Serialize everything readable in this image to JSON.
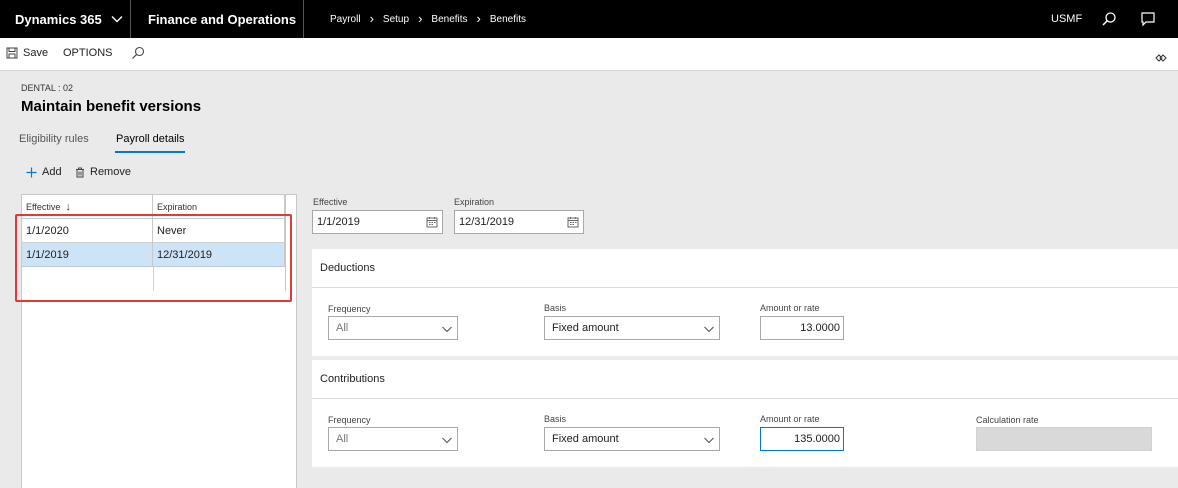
{
  "nav": {
    "brand": "Dynamics 365",
    "app": "Finance and Operations",
    "breadcrumb": [
      "Payroll",
      "Setup",
      "Benefits",
      "Benefits"
    ],
    "company": "USMF"
  },
  "actionbar": {
    "save_label": "Save",
    "options_label": "OPTIONS"
  },
  "header": {
    "caption": "DENTAL : 02",
    "title": "Maintain benefit versions"
  },
  "tabs": [
    {
      "label": "Eligibility rules",
      "active": false
    },
    {
      "label": "Payroll details",
      "active": true
    }
  ],
  "grid_toolbar": {
    "add_label": "Add",
    "remove_label": "Remove"
  },
  "grid": {
    "columns": [
      "Effective",
      "Expiration"
    ],
    "sort_indicator": "↓",
    "rows": [
      {
        "effective": "1/1/2020",
        "expiration": "Never",
        "selected": false
      },
      {
        "effective": "1/1/2019",
        "expiration": "12/31/2019",
        "selected": true
      }
    ]
  },
  "dates": {
    "effective_label": "Effective",
    "effective_value": "1/1/2019",
    "expiration_label": "Expiration",
    "expiration_value": "12/31/2019"
  },
  "deductions": {
    "title": "Deductions",
    "frequency_label": "Frequency",
    "frequency_value": "All",
    "basis_label": "Basis",
    "basis_value": "Fixed amount",
    "amount_label": "Amount or rate",
    "amount_value": "13.0000"
  },
  "contributions": {
    "title": "Contributions",
    "frequency_label": "Frequency",
    "frequency_value": "All",
    "basis_label": "Basis",
    "basis_value": "Fixed amount",
    "amount_label": "Amount or rate",
    "amount_value": "135.0000",
    "calc_rate_label": "Calculation rate",
    "calc_rate_value": ""
  },
  "colors": {
    "nav_bg": "#000000",
    "accent": "#0078d4",
    "selected_row": "#cde3f6",
    "highlight_box": "#e23838"
  }
}
